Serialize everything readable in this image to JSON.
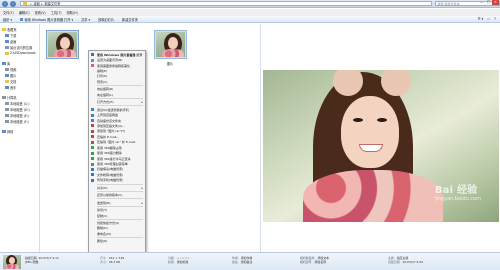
{
  "window": {
    "breadcrumb": [
      "桌面",
      "新建文件夹"
    ],
    "search_placeholder": "搜索 新建文件夹",
    "controls": [
      "—",
      "□",
      "✕"
    ]
  },
  "menubar": [
    "文件(F)",
    "编辑(E)",
    "查看(V)",
    "工具(T)",
    "帮助(H)"
  ],
  "toolbar": {
    "items": [
      "组织 ▾",
      "使用 Windows 照片查看器 打开 ▾",
      "共享 ▾",
      "放映幻灯片",
      "新建文件夹"
    ],
    "view_icons": [
      "☰ ▾",
      "▭",
      "?"
    ]
  },
  "sidebar": {
    "groups": [
      {
        "header": "收藏夹",
        "icon": "star-icon",
        "items": [
          "下载",
          "桌面",
          "最近访问的位置",
          "2345Downloads"
        ]
      },
      {
        "header": "库",
        "icon": "library-icon",
        "items": [
          "视频",
          "图片",
          "文档",
          "音乐"
        ]
      },
      {
        "header": "计算机",
        "icon": "computer-icon",
        "items": [
          "本地磁盘 (C:)",
          "本地磁盘 (D:)",
          "本地磁盘 (E:)",
          "本地磁盘 (F:)"
        ]
      },
      {
        "header": "网络",
        "icon": "network-icon",
        "items": []
      }
    ]
  },
  "files": [
    {
      "name": "",
      "selected": true
    },
    {
      "name": "图片",
      "selected": false
    }
  ],
  "context_menu": [
    {
      "label": "使用 Windows 照片查看器 打开",
      "bold": true,
      "color": "#3c6fb6"
    },
    {
      "label": "设置为桌面背景(B)",
      "color": "#6a8fc0"
    },
    {
      "label": "使用美图秀秀编辑和美化",
      "color": "#e05a8a"
    },
    {
      "label": "编辑(E)",
      "color": ""
    },
    {
      "label": "打印(P)",
      "color": ""
    },
    {
      "label": "预览(V)",
      "color": ""
    },
    {
      "sep": true
    },
    {
      "label": "向右旋转(R)",
      "color": ""
    },
    {
      "label": "向左旋转(L)",
      "color": ""
    },
    {
      "sep": true
    },
    {
      "label": "打开方式(H)",
      "color": "",
      "arrow": true
    },
    {
      "sep": true
    },
    {
      "label": "通过QQ发送到我的手机",
      "color": "#2b8ad8"
    },
    {
      "label": "上传到百度网盘",
      "color": "#3c7fd6"
    },
    {
      "label": "自动备份该文件夹",
      "color": "#3c7fd6"
    },
    {
      "label": "添加到压缩文件(A)...",
      "color": "#b34b4b"
    },
    {
      "label": "添加到 \"图片.rar\"(T)",
      "color": "#b34b4b"
    },
    {
      "label": "压缩并 E-mail...",
      "color": "#b34b4b"
    },
    {
      "label": "压缩到 \"图片.rar\" 并 E-mail",
      "color": "#b34b4b"
    },
    {
      "label": "使用 360解除占用",
      "color": "#3aa04c"
    },
    {
      "label": "使用 360强力删除",
      "color": "#3aa04c"
    },
    {
      "label": "使用 360进行木马云查杀",
      "color": "#3aa04c"
    },
    {
      "label": "使用 360管理右键菜单",
      "color": "#3aa04c"
    },
    {
      "label": "扫描病毒(电脑管家)",
      "color": "#2c7ad1"
    },
    {
      "label": "文件粉碎(电脑管家)",
      "color": "#2c7ad1"
    },
    {
      "label": "传到手机(电脑管家)",
      "color": "#2c7ad1"
    },
    {
      "sep": true
    },
    {
      "label": "共享(H)",
      "color": "",
      "arrow": true
    },
    {
      "sep": true
    },
    {
      "label": "还原以前的版本(V)",
      "color": ""
    },
    {
      "sep": true
    },
    {
      "label": "发送到(N)",
      "color": "",
      "arrow": true
    },
    {
      "sep": true
    },
    {
      "label": "剪切(T)",
      "color": ""
    },
    {
      "label": "复制(C)",
      "color": ""
    },
    {
      "sep": true
    },
    {
      "label": "创建快捷方式(S)",
      "color": ""
    },
    {
      "label": "删除(D)",
      "color": ""
    },
    {
      "label": "重命名(M)",
      "color": ""
    },
    {
      "sep": true
    },
    {
      "label": "属性(R)",
      "color": ""
    }
  ],
  "watermark": {
    "brand": "Bai 经验",
    "sub": "jingyan.baidu.com"
  },
  "details": {
    "col1": [
      {
        "k": "",
        "v": "拍摄日期: 2015/5/7 9:12"
      },
      {
        "k": "",
        "v": "JPEG 图像"
      }
    ],
    "col2": [
      {
        "k": "尺寸:",
        "v": "452 × 338"
      },
      {
        "k": "大小:",
        "v": "36.3 KB"
      }
    ],
    "col3": [
      {
        "k": "分级:",
        "v": "☆☆☆☆☆"
      },
      {
        "k": "标题:",
        "v": "添加标题"
      }
    ],
    "col4": [
      {
        "k": "作者:",
        "v": "添加作者"
      },
      {
        "k": "备注:",
        "v": "添加备注"
      }
    ],
    "col5": [
      {
        "k": "相机制造商:",
        "v": "添加文本"
      },
      {
        "k": "相机型号:",
        "v": "添加名称"
      }
    ],
    "col6": [
      {
        "k": "主题:",
        "v": "指定主题"
      },
      {
        "k": "创建日期:",
        "v": "2015/5/7 9:44"
      }
    ]
  }
}
